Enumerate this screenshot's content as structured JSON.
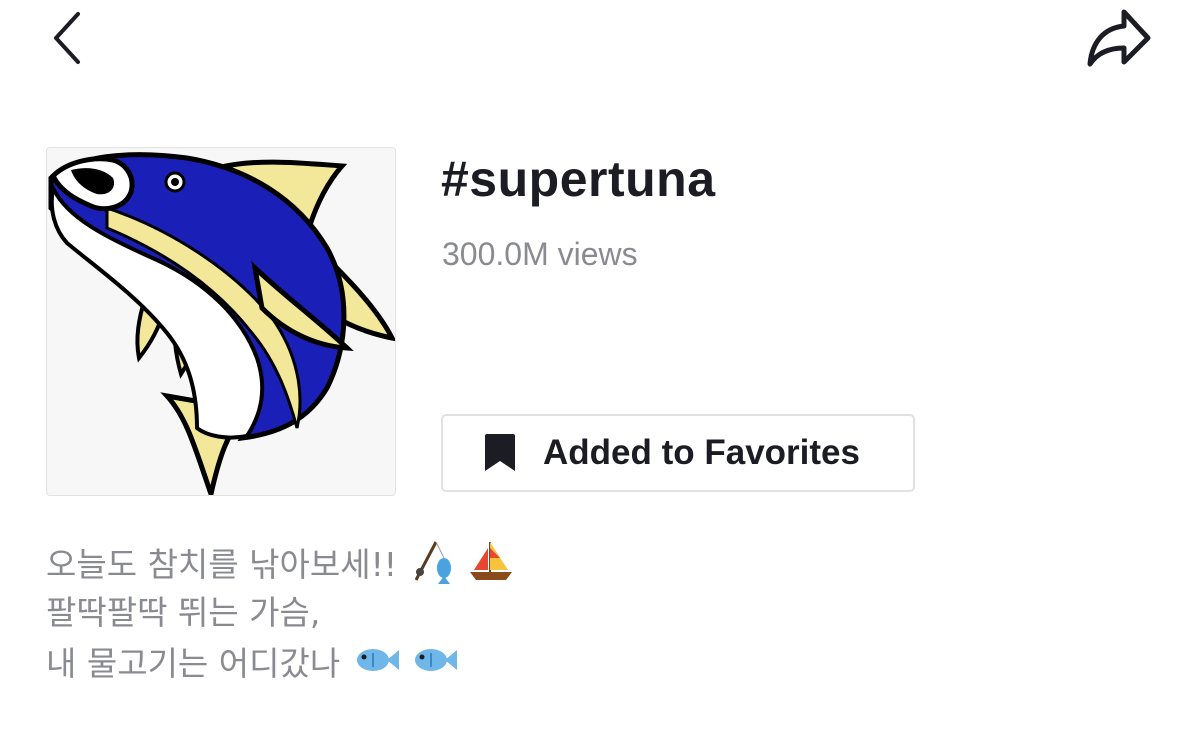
{
  "header": {
    "back_icon": "chevron-left-icon",
    "share_icon": "share-arrow-icon"
  },
  "hashtag": {
    "title": "#supertuna",
    "views": "300.0M views",
    "cover_icon": "tuna-fish-illustration"
  },
  "favorite_button": {
    "label": "Added to Favorites",
    "icon": "bookmark-icon"
  },
  "description": {
    "lines": [
      "오늘도 참치를 낚아보세!!",
      "팔딱팔딱 뛰는 가슴,",
      "내 물고기는 어디갔나"
    ],
    "emojis_line1": [
      "fishing-pole-emoji",
      "sailboat-emoji"
    ],
    "emojis_line3": [
      "fish-emoji",
      "fish-emoji"
    ]
  },
  "colors": {
    "title": "#1c1c24",
    "secondary_text": "#8a8b91",
    "tuna_blue": "#1a1fb8",
    "tuna_yellow": "#f3e89a",
    "border": "#e1e1e3"
  }
}
